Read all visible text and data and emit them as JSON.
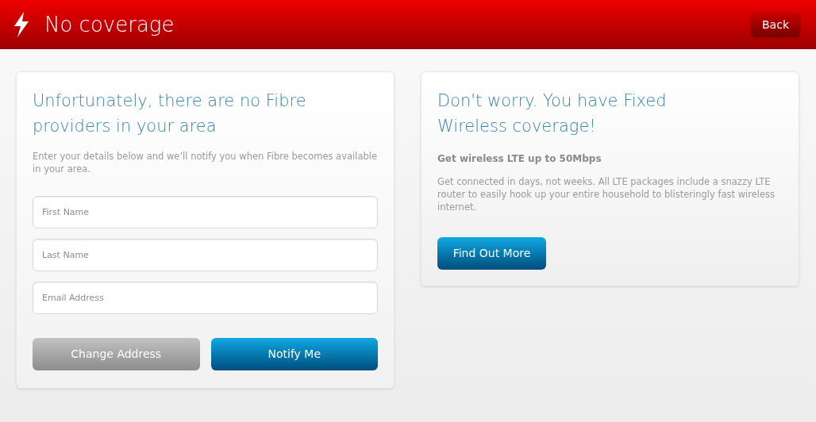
{
  "header": {
    "title": "No coverage",
    "back_button": "Back"
  },
  "form_card": {
    "heading": "Unfortunately, there are no Fibre providers in your area",
    "intro": "Enter your details below and we’ll notify you when Fibre becomes available in your area.",
    "fields": [
      {
        "placeholder": "First Name"
      },
      {
        "placeholder": "Last Name"
      },
      {
        "placeholder": "Email Address"
      }
    ],
    "buttons": [
      {
        "label": "Change Address",
        "kind": "secondary"
      },
      {
        "label": "Notify Me",
        "kind": "primary"
      }
    ]
  },
  "wireless_card": {
    "heading": "Don't worry. You have Fixed Wireless coverage!",
    "subheading": "Get wireless LTE up to 50Mbps",
    "body": "Get connected in days, not weeks. All LTE packages include a snazzy LTE router to easily hook up your entire household to blisteringly fast wireless internet.",
    "button": {
      "label": "Find Out More",
      "kind": "primary"
    }
  }
}
